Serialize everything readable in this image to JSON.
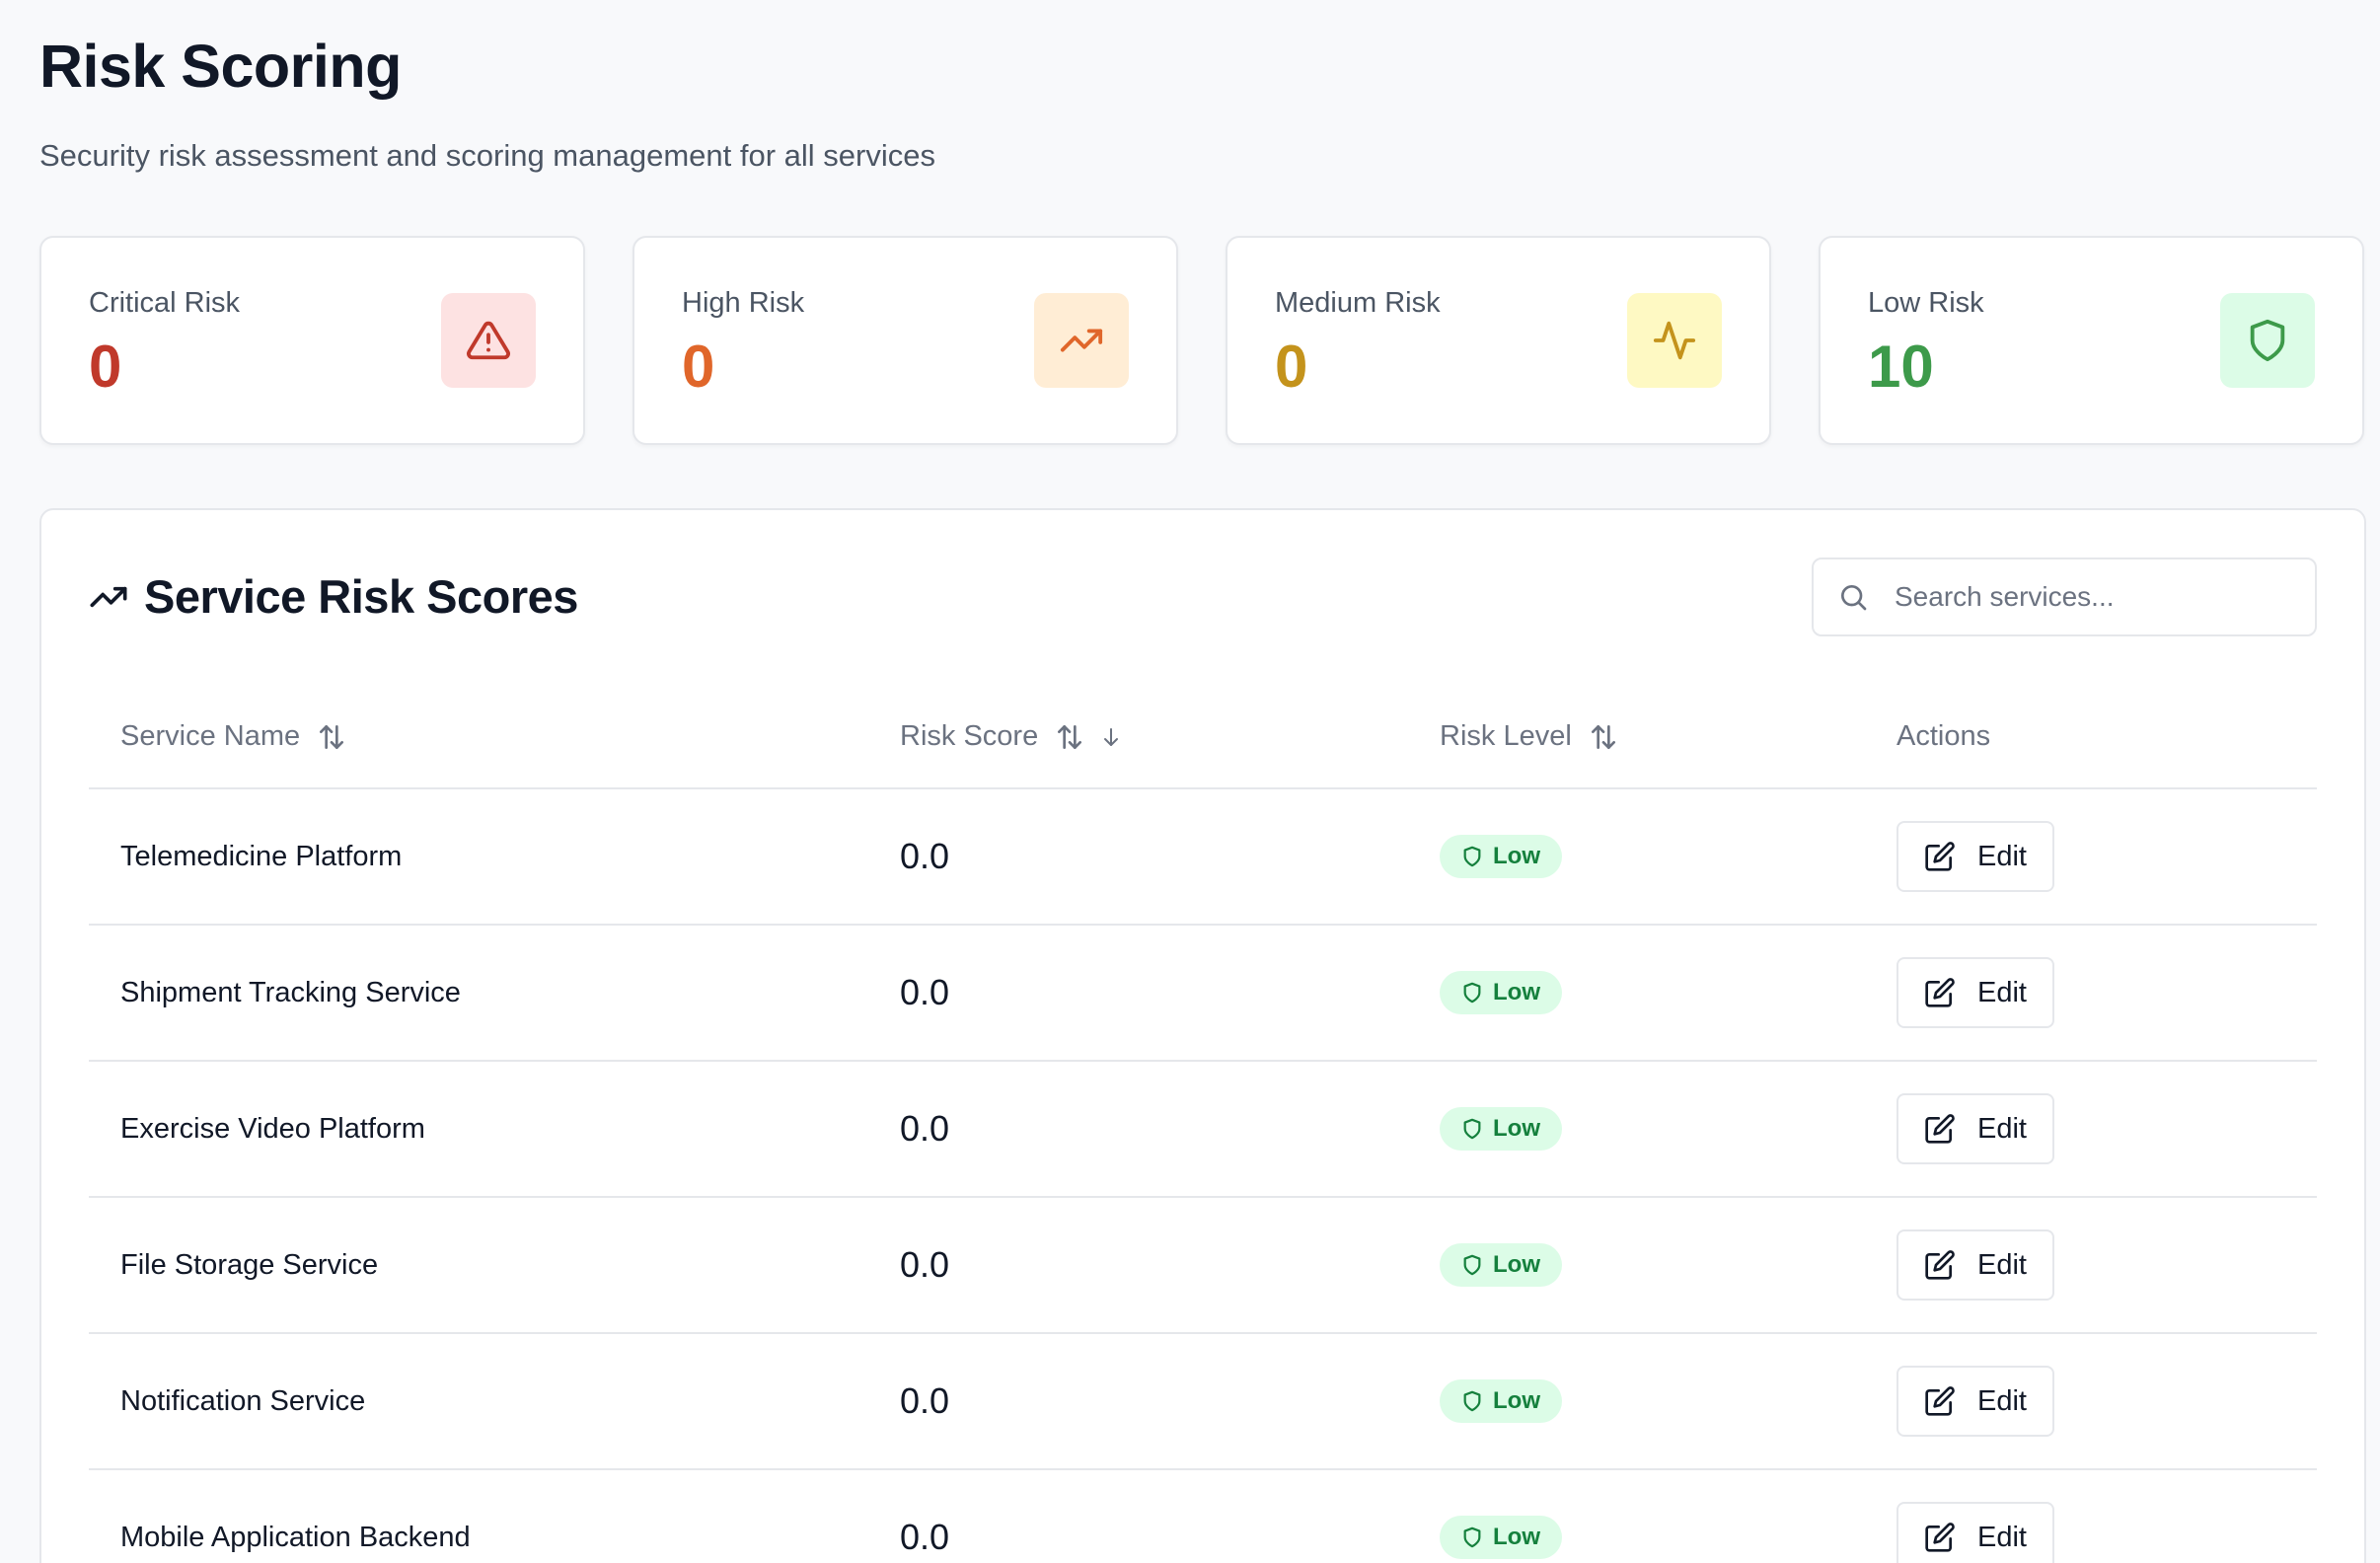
{
  "page": {
    "title": "Risk Scoring",
    "subtitle": "Security risk assessment and scoring management for all services"
  },
  "stats": [
    {
      "label": "Critical Risk",
      "value": "0",
      "icon": "alert-triangle-icon",
      "color": "#c0392b",
      "bg": "#fde2e2"
    },
    {
      "label": "High Risk",
      "value": "0",
      "icon": "trending-up-icon",
      "color": "#e0662a",
      "bg": "#ffedd5"
    },
    {
      "label": "Medium Risk",
      "value": "0",
      "icon": "activity-icon",
      "color": "#c4931c",
      "bg": "#fef9c3"
    },
    {
      "label": "Low Risk",
      "value": "10",
      "icon": "shield-icon",
      "color": "#3d9a4a",
      "bg": "#dcfce7"
    }
  ],
  "panel": {
    "title": "Service Risk Scores",
    "search_placeholder": "Search services..."
  },
  "table": {
    "headers": {
      "service_name": "Service Name",
      "risk_score": "Risk Score",
      "risk_level": "Risk Level",
      "actions": "Actions"
    },
    "rows": [
      {
        "name": "Telemedicine Platform",
        "score": "0.0",
        "level": "Low",
        "action": "Edit"
      },
      {
        "name": "Shipment Tracking Service",
        "score": "0.0",
        "level": "Low",
        "action": "Edit"
      },
      {
        "name": "Exercise Video Platform",
        "score": "0.0",
        "level": "Low",
        "action": "Edit"
      },
      {
        "name": "File Storage Service",
        "score": "0.0",
        "level": "Low",
        "action": "Edit"
      },
      {
        "name": "Notification Service",
        "score": "0.0",
        "level": "Low",
        "action": "Edit"
      },
      {
        "name": "Mobile Application Backend",
        "score": "0.0",
        "level": "Low",
        "action": "Edit"
      }
    ]
  }
}
